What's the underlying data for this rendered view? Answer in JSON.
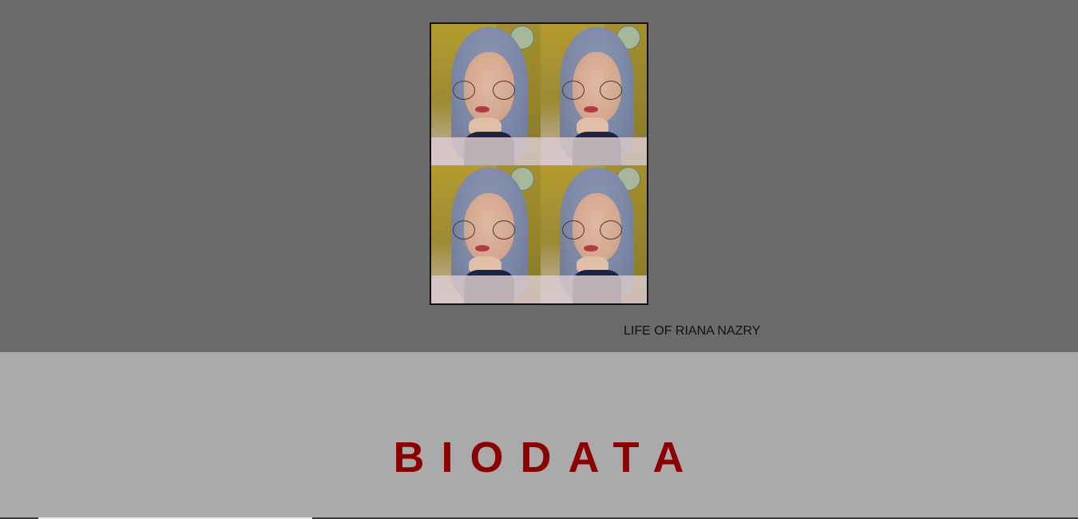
{
  "hero": {
    "photo": {
      "tiles": [
        {
          "name": "photo-tile-1"
        },
        {
          "name": "photo-tile-2"
        },
        {
          "name": "photo-tile-3"
        },
        {
          "name": "photo-tile-4"
        }
      ]
    },
    "caption": "LIFE OF RIANA NAZRY"
  },
  "biodata": {
    "title": "BIODATA"
  },
  "colors": {
    "hero_background": "#6b6b6b",
    "section_background": "#aaaaaa",
    "title_color": "#8b0000"
  }
}
